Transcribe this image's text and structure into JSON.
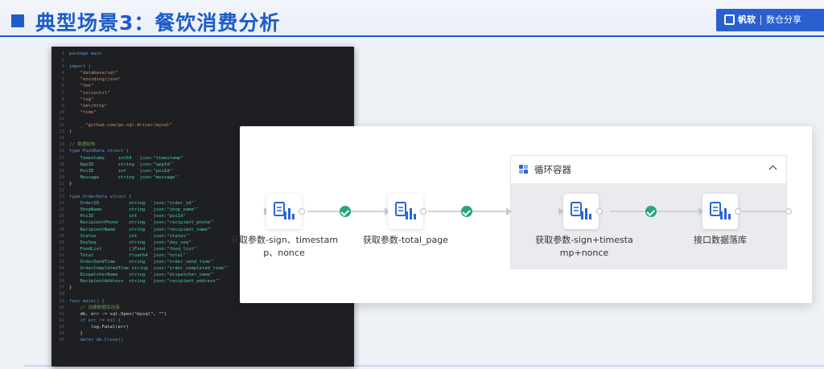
{
  "header": {
    "title": "典型场景3：餐饮消费分析",
    "brand_name": "帆软",
    "brand_product": "数仓分享"
  },
  "code": [
    [
      "1",
      "package main"
    ],
    [
      "2",
      ""
    ],
    [
      "3",
      "import ("
    ],
    [
      "4",
      "    \"database/sql\""
    ],
    [
      "5",
      "    \"encoding/json\""
    ],
    [
      "6",
      "    \"fmt\""
    ],
    [
      "7",
      "    \"io/ioutil\""
    ],
    [
      "8",
      "    \"log\""
    ],
    [
      "9",
      "    \"net/http\""
    ],
    [
      "10",
      "    \"time\""
    ],
    [
      "11",
      ""
    ],
    [
      "12",
      "    _ \"github.com/go-sql-driver/mysql\""
    ],
    [
      "13",
      ")"
    ],
    [
      "14",
      ""
    ],
    [
      "15",
      "// 数据结构"
    ],
    [
      "16",
      "type PushData struct {"
    ],
    [
      "17",
      "    Timestamp     int64  `json:\"timestamp\"`"
    ],
    [
      "18",
      "    AppID         string `json:\"appId\"`"
    ],
    [
      "19",
      "    PoiID         int    `json:\"poiId\"`"
    ],
    [
      "20",
      "    Message       string `json:\"message\"`"
    ],
    [
      "21",
      "}"
    ],
    [
      "22",
      ""
    ],
    [
      "23",
      "type OrderData struct {"
    ],
    [
      "24",
      "    OrderID           string  `json:\"order_id\"`"
    ],
    [
      "25",
      "    ShopName          string  `json:\"shop_name\"`"
    ],
    [
      "26",
      "    PoiID             int     `json:\"poiId\"`"
    ],
    [
      "27",
      "    RecipientPhone    string  `json:\"recipient_phone\"`"
    ],
    [
      "28",
      "    RecipientName     string  `json:\"recipient_name\"`"
    ],
    [
      "29",
      "    Status            int     `json:\"status\"`"
    ],
    [
      "30",
      "    DaySeq            string  `json:\"day_seq\"`"
    ],
    [
      "31",
      "    FoodList          []Food  `json:\"food_list\"`"
    ],
    [
      "32",
      "    Total             float64 `json:\"total\"`"
    ],
    [
      "33",
      "    OrderSendTime     string  `json:\"order_send_time\"`"
    ],
    [
      "34",
      "    OrderCompletedTime string `json:\"order_completed_time\"`"
    ],
    [
      "35",
      "    DispatcherName    string  `json:\"dispatcher_name\"`"
    ],
    [
      "36",
      "    RecipientAddress  string  `json:\"recipient_address\"`"
    ],
    [
      "37",
      "}"
    ],
    [
      "38",
      ""
    ],
    [
      "39",
      "func main() {"
    ],
    [
      "40",
      "    // 创建数据库连接"
    ],
    [
      "41",
      "    db, err := sql.Open(\"mysql\", \"\")"
    ],
    [
      "42",
      "    if err != nil {"
    ],
    [
      "43",
      "        log.Fatal(err)"
    ],
    [
      "44",
      "    }"
    ],
    [
      "45",
      "    defer db.Close()"
    ]
  ],
  "flow": {
    "nodes": [
      {
        "label": "获取参数-sign、timestamp、nonce"
      },
      {
        "label": "获取参数-total_page"
      },
      {
        "label": "获取参数-sign+timestamp+nonce"
      },
      {
        "label": "接口数据落库"
      }
    ],
    "loop_container": {
      "title": "循环容器"
    },
    "status_color": "#27a77a",
    "accent": "#2a64d6"
  }
}
